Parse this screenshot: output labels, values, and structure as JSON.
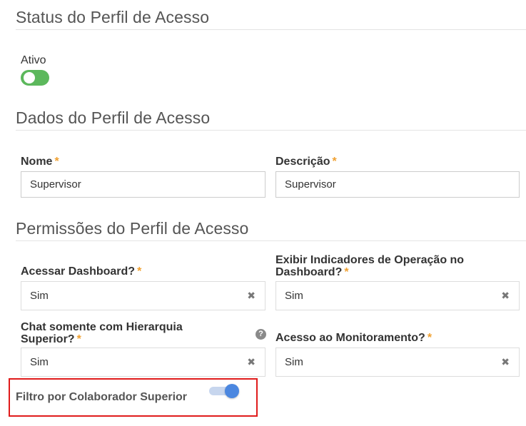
{
  "status_section": {
    "title": "Status do Perfil de Acesso",
    "active_label": "Ativo",
    "active_toggle_on": true,
    "toggle_color": "#5cb85c"
  },
  "data_section": {
    "title": "Dados do Perfil de Acesso",
    "name_label": "Nome",
    "name_value": "Supervisor",
    "description_label": "Descrição",
    "description_value": "Supervisor",
    "required_mark": "*"
  },
  "permissions_section": {
    "title": "Permissões do Perfil de Acesso",
    "fields": [
      {
        "label": "Acessar Dashboard?",
        "value": "Sim"
      },
      {
        "label": "Exibir Indicadores de Operação no Dashboard?",
        "value": "Sim"
      },
      {
        "label": "Chat somente com Hierarquia Superior?",
        "value": "Sim",
        "help_icon": "question-circle-icon"
      },
      {
        "label": "Acesso ao Monitoramento?",
        "value": "Sim"
      }
    ],
    "clear_icon": "✖",
    "help_glyph": "?",
    "filter_label": "Filtro por Colaborador Superior",
    "filter_toggle_on": true,
    "filter_toggle_color": "#4b87e0",
    "highlight_color": "#e01b1b"
  }
}
